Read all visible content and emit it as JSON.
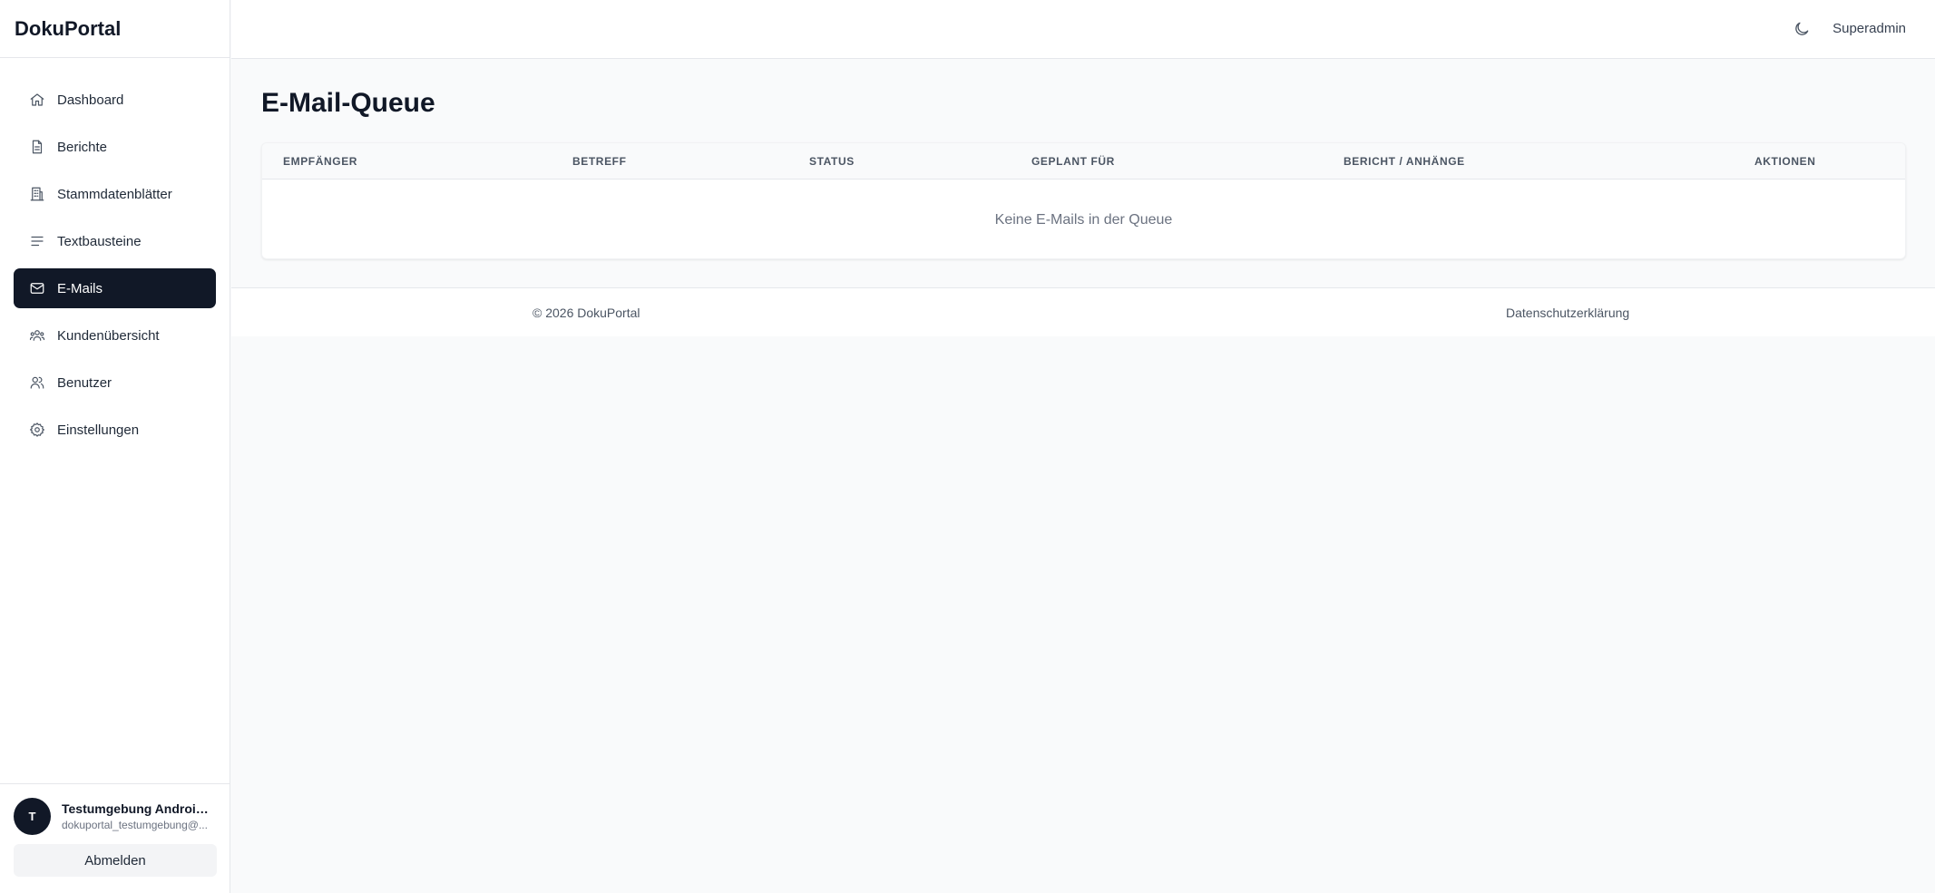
{
  "app": {
    "title": "DokuPortal"
  },
  "sidebar": {
    "items": [
      {
        "label": "Dashboard",
        "icon": "home-icon",
        "active": false
      },
      {
        "label": "Berichte",
        "icon": "document-icon",
        "active": false
      },
      {
        "label": "Stammdatenblätter",
        "icon": "building-icon",
        "active": false
      },
      {
        "label": "Textbausteine",
        "icon": "text-lines-icon",
        "active": false
      },
      {
        "label": "E-Mails",
        "icon": "mail-icon",
        "active": true
      },
      {
        "label": "Kundenübersicht",
        "icon": "customers-icon",
        "active": false
      },
      {
        "label": "Benutzer",
        "icon": "users-icon",
        "active": false
      },
      {
        "label": "Einstellungen",
        "icon": "gear-icon",
        "active": false
      }
    ]
  },
  "user": {
    "initial": "T",
    "name": "Testumgebung Androidi...",
    "email": "dokuportal_testumgebung@...",
    "logout_label": "Abmelden"
  },
  "topbar": {
    "theme_icon": "moon-icon",
    "user_label": "Superadmin"
  },
  "page": {
    "title": "E-Mail-Queue",
    "table": {
      "columns": [
        "EMPFÄNGER",
        "BETREFF",
        "STATUS",
        "GEPLANT FÜR",
        "BERICHT / ANHÄNGE",
        "AKTIONEN"
      ],
      "empty_text": "Keine E-Mails in der Queue"
    }
  },
  "footer": {
    "copyright": "© 2026 DokuPortal",
    "privacy_label": "Datenschutzerklärung"
  },
  "colors": {
    "accent": "#111827",
    "background": "#f9fafb",
    "surface": "#ffffff",
    "border": "#e5e7eb"
  }
}
